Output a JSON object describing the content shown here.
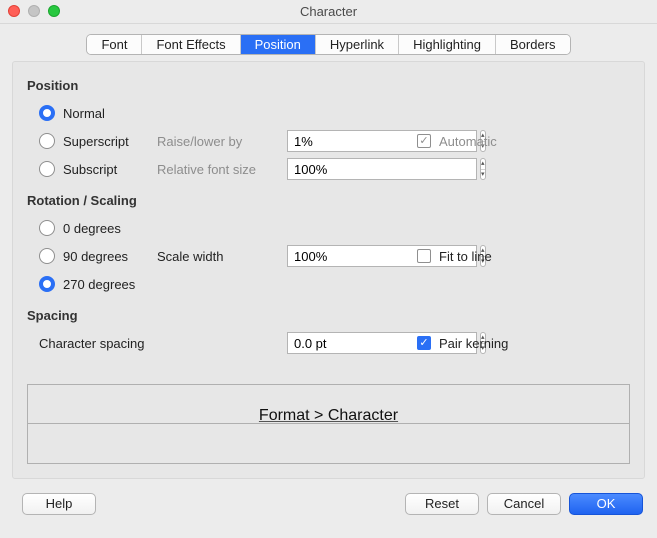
{
  "window": {
    "title": "Character"
  },
  "tabs": {
    "font": "Font",
    "font_effects": "Font Effects",
    "position": "Position",
    "hyperlink": "Hyperlink",
    "highlighting": "Highlighting",
    "borders": "Borders",
    "selected": "position"
  },
  "position": {
    "title": "Position",
    "normal": "Normal",
    "superscript": "Superscript",
    "subscript": "Subscript",
    "raise_lower_label": "Raise/lower by",
    "raise_lower_value": "1%",
    "relative_size_label": "Relative font size",
    "relative_size_value": "100%",
    "automatic": "Automatic"
  },
  "rotation": {
    "title": "Rotation / Scaling",
    "deg0": "0 degrees",
    "deg90": "90 degrees",
    "deg270": "270 degrees",
    "scale_width_label": "Scale width",
    "scale_width_value": "100%",
    "fit_to_line": "Fit to line"
  },
  "spacing": {
    "title": "Spacing",
    "char_spacing_label": "Character spacing",
    "char_spacing_value": "0.0 pt",
    "pair_kerning": "Pair kerning"
  },
  "preview": {
    "text": "Format > Character"
  },
  "buttons": {
    "help": "Help",
    "reset": "Reset",
    "cancel": "Cancel",
    "ok": "OK"
  }
}
